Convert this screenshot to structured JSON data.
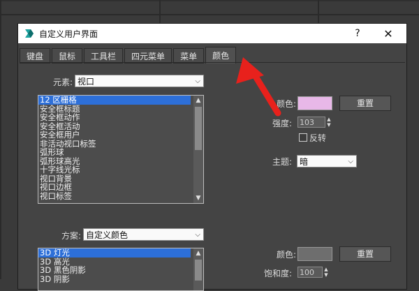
{
  "window": {
    "title": "自定义用户界面",
    "help_label": "?",
    "close_label": "✕"
  },
  "tabs": [
    {
      "label": "键盘"
    },
    {
      "label": "鼠标"
    },
    {
      "label": "工具栏"
    },
    {
      "label": "四元菜单"
    },
    {
      "label": "菜单"
    },
    {
      "label": "颜色",
      "active": true
    }
  ],
  "elements": {
    "label": "元素:",
    "selected": "视口",
    "items": [
      "12 区栅格",
      "安全框标题",
      "安全框动作",
      "安全框活动",
      "安全框用户",
      "非活动视口标签",
      "弧形球",
      "弧形球高光",
      "十字线光标",
      "视口背景",
      "视口边框",
      "视口标签"
    ]
  },
  "scheme": {
    "label": "方案:",
    "selected": "自定义颜色",
    "items": [
      "3D 灯光",
      "3D 高光",
      "3D 黑色阴影",
      "3D 阴影"
    ]
  },
  "color_panel_top": {
    "color_label": "颜色:",
    "color_hex": "#e8b8e8",
    "reset_label": "重置",
    "intensity_label": "强度:",
    "intensity_value": "103",
    "invert_label": "反转",
    "theme_label": "主题:",
    "theme_value": "暗"
  },
  "color_panel_bottom": {
    "color_label": "颜色:",
    "color_hex": "#6e6e6e",
    "reset_label": "重置",
    "saturation_label": "饱和度:",
    "saturation_value": "100"
  },
  "colors": {
    "selection": "#2d6fd8",
    "annotation_arrow": "#e8211c"
  },
  "icons": {
    "app": "3dsmax-logo-icon",
    "dropdown": "chevron-down-icon",
    "scroll_up": "scroll-up-icon",
    "scroll_down": "scroll-down-icon"
  }
}
